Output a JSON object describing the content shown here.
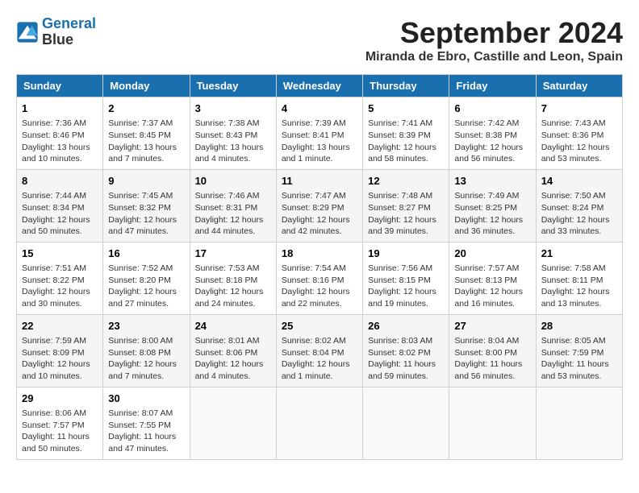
{
  "header": {
    "logo_line1": "General",
    "logo_line2": "Blue",
    "month_title": "September 2024",
    "location": "Miranda de Ebro, Castille and Leon, Spain"
  },
  "days_of_week": [
    "Sunday",
    "Monday",
    "Tuesday",
    "Wednesday",
    "Thursday",
    "Friday",
    "Saturday"
  ],
  "weeks": [
    [
      {
        "day": "1",
        "info": "Sunrise: 7:36 AM\nSunset: 8:46 PM\nDaylight: 13 hours and 10 minutes."
      },
      {
        "day": "2",
        "info": "Sunrise: 7:37 AM\nSunset: 8:45 PM\nDaylight: 13 hours and 7 minutes."
      },
      {
        "day": "3",
        "info": "Sunrise: 7:38 AM\nSunset: 8:43 PM\nDaylight: 13 hours and 4 minutes."
      },
      {
        "day": "4",
        "info": "Sunrise: 7:39 AM\nSunset: 8:41 PM\nDaylight: 13 hours and 1 minute."
      },
      {
        "day": "5",
        "info": "Sunrise: 7:41 AM\nSunset: 8:39 PM\nDaylight: 12 hours and 58 minutes."
      },
      {
        "day": "6",
        "info": "Sunrise: 7:42 AM\nSunset: 8:38 PM\nDaylight: 12 hours and 56 minutes."
      },
      {
        "day": "7",
        "info": "Sunrise: 7:43 AM\nSunset: 8:36 PM\nDaylight: 12 hours and 53 minutes."
      }
    ],
    [
      {
        "day": "8",
        "info": "Sunrise: 7:44 AM\nSunset: 8:34 PM\nDaylight: 12 hours and 50 minutes."
      },
      {
        "day": "9",
        "info": "Sunrise: 7:45 AM\nSunset: 8:32 PM\nDaylight: 12 hours and 47 minutes."
      },
      {
        "day": "10",
        "info": "Sunrise: 7:46 AM\nSunset: 8:31 PM\nDaylight: 12 hours and 44 minutes."
      },
      {
        "day": "11",
        "info": "Sunrise: 7:47 AM\nSunset: 8:29 PM\nDaylight: 12 hours and 42 minutes."
      },
      {
        "day": "12",
        "info": "Sunrise: 7:48 AM\nSunset: 8:27 PM\nDaylight: 12 hours and 39 minutes."
      },
      {
        "day": "13",
        "info": "Sunrise: 7:49 AM\nSunset: 8:25 PM\nDaylight: 12 hours and 36 minutes."
      },
      {
        "day": "14",
        "info": "Sunrise: 7:50 AM\nSunset: 8:24 PM\nDaylight: 12 hours and 33 minutes."
      }
    ],
    [
      {
        "day": "15",
        "info": "Sunrise: 7:51 AM\nSunset: 8:22 PM\nDaylight: 12 hours and 30 minutes."
      },
      {
        "day": "16",
        "info": "Sunrise: 7:52 AM\nSunset: 8:20 PM\nDaylight: 12 hours and 27 minutes."
      },
      {
        "day": "17",
        "info": "Sunrise: 7:53 AM\nSunset: 8:18 PM\nDaylight: 12 hours and 24 minutes."
      },
      {
        "day": "18",
        "info": "Sunrise: 7:54 AM\nSunset: 8:16 PM\nDaylight: 12 hours and 22 minutes."
      },
      {
        "day": "19",
        "info": "Sunrise: 7:56 AM\nSunset: 8:15 PM\nDaylight: 12 hours and 19 minutes."
      },
      {
        "day": "20",
        "info": "Sunrise: 7:57 AM\nSunset: 8:13 PM\nDaylight: 12 hours and 16 minutes."
      },
      {
        "day": "21",
        "info": "Sunrise: 7:58 AM\nSunset: 8:11 PM\nDaylight: 12 hours and 13 minutes."
      }
    ],
    [
      {
        "day": "22",
        "info": "Sunrise: 7:59 AM\nSunset: 8:09 PM\nDaylight: 12 hours and 10 minutes."
      },
      {
        "day": "23",
        "info": "Sunrise: 8:00 AM\nSunset: 8:08 PM\nDaylight: 12 hours and 7 minutes."
      },
      {
        "day": "24",
        "info": "Sunrise: 8:01 AM\nSunset: 8:06 PM\nDaylight: 12 hours and 4 minutes."
      },
      {
        "day": "25",
        "info": "Sunrise: 8:02 AM\nSunset: 8:04 PM\nDaylight: 12 hours and 1 minute."
      },
      {
        "day": "26",
        "info": "Sunrise: 8:03 AM\nSunset: 8:02 PM\nDaylight: 11 hours and 59 minutes."
      },
      {
        "day": "27",
        "info": "Sunrise: 8:04 AM\nSunset: 8:00 PM\nDaylight: 11 hours and 56 minutes."
      },
      {
        "day": "28",
        "info": "Sunrise: 8:05 AM\nSunset: 7:59 PM\nDaylight: 11 hours and 53 minutes."
      }
    ],
    [
      {
        "day": "29",
        "info": "Sunrise: 8:06 AM\nSunset: 7:57 PM\nDaylight: 11 hours and 50 minutes."
      },
      {
        "day": "30",
        "info": "Sunrise: 8:07 AM\nSunset: 7:55 PM\nDaylight: 11 hours and 47 minutes."
      },
      {
        "day": "",
        "info": ""
      },
      {
        "day": "",
        "info": ""
      },
      {
        "day": "",
        "info": ""
      },
      {
        "day": "",
        "info": ""
      },
      {
        "day": "",
        "info": ""
      }
    ]
  ]
}
